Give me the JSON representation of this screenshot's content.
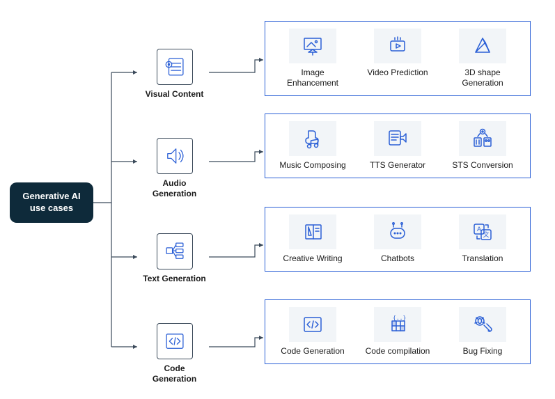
{
  "root": {
    "title": "Generative AI use cases"
  },
  "categories": [
    {
      "label": "Visual Content",
      "icon": "visual-content-icon"
    },
    {
      "label": "Audio Generation",
      "icon": "audio-icon"
    },
    {
      "label": "Text Generation",
      "icon": "text-icon"
    },
    {
      "label": "Code Generation",
      "icon": "code-icon"
    }
  ],
  "usecases": [
    {
      "items": [
        {
          "label": "Image Enhancement",
          "icon": "image-enhance-icon"
        },
        {
          "label": "Video Prediction",
          "icon": "video-icon"
        },
        {
          "label": "3D shape Generation",
          "icon": "3d-shape-icon"
        }
      ]
    },
    {
      "items": [
        {
          "label": "Music Composing",
          "icon": "music-icon"
        },
        {
          "label": "TTS Generator",
          "icon": "tts-icon"
        },
        {
          "label": "STS Conversion",
          "icon": "sts-icon"
        }
      ]
    },
    {
      "items": [
        {
          "label": "Creative Writing",
          "icon": "writing-icon"
        },
        {
          "label": "Chatbots",
          "icon": "chatbot-icon"
        },
        {
          "label": "Translation",
          "icon": "translation-icon"
        }
      ]
    },
    {
      "items": [
        {
          "label": "Code Generation",
          "icon": "code-gen-icon"
        },
        {
          "label": "Code compilation",
          "icon": "compile-icon"
        },
        {
          "label": "Bug Fixing",
          "icon": "bug-icon"
        }
      ]
    }
  ],
  "colors": {
    "accent": "#2a5fd6",
    "dark": "#0e2a3a",
    "iconbg": "#f2f5f8"
  }
}
